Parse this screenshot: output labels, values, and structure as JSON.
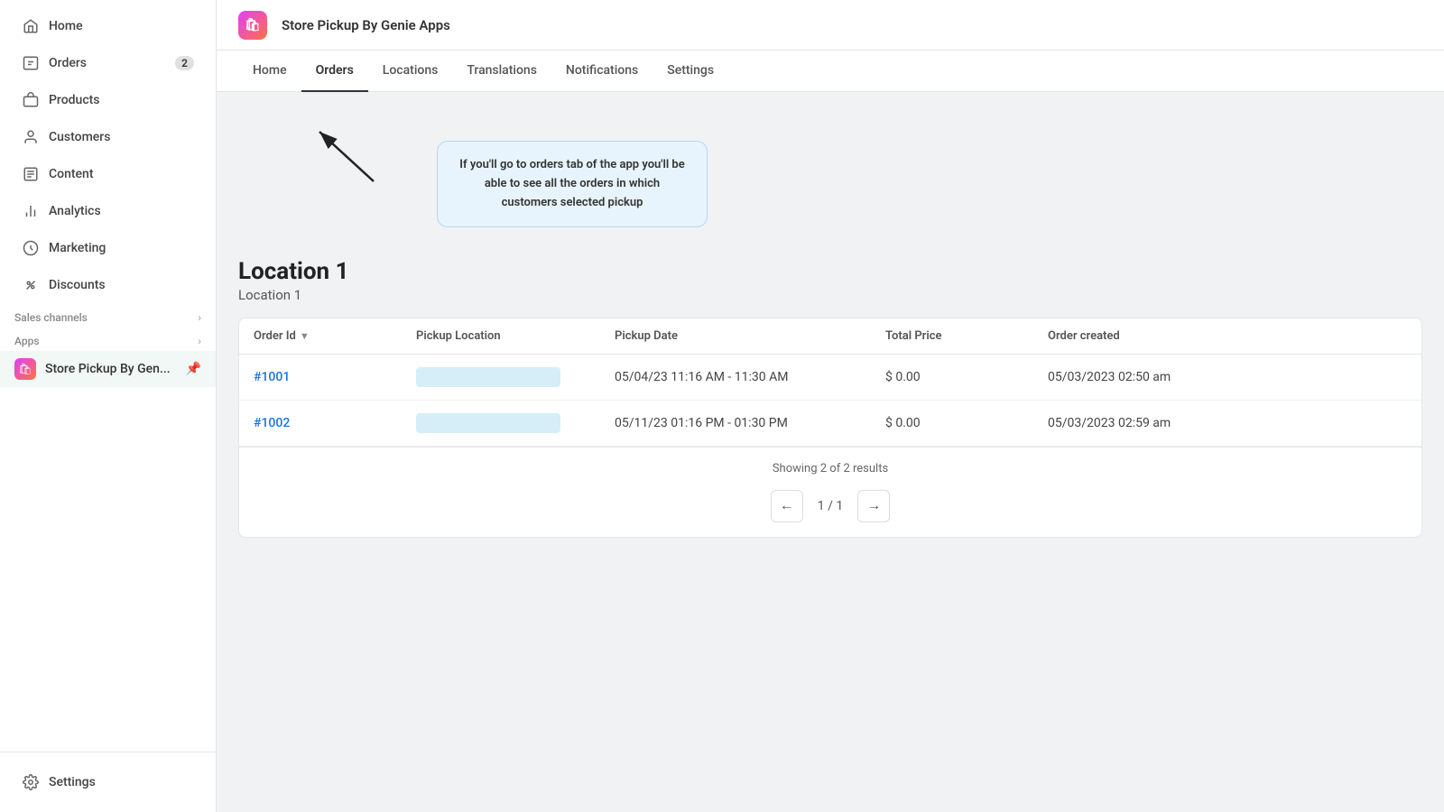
{
  "sidebar": {
    "items": [
      {
        "id": "home",
        "label": "Home",
        "icon": "home-icon",
        "badge": null
      },
      {
        "id": "orders",
        "label": "Orders",
        "icon": "orders-icon",
        "badge": "2"
      },
      {
        "id": "products",
        "label": "Products",
        "icon": "products-icon",
        "badge": null
      },
      {
        "id": "customers",
        "label": "Customers",
        "icon": "customers-icon",
        "badge": null
      },
      {
        "id": "content",
        "label": "Content",
        "icon": "content-icon",
        "badge": null
      },
      {
        "id": "analytics",
        "label": "Analytics",
        "icon": "analytics-icon",
        "badge": null
      },
      {
        "id": "marketing",
        "label": "Marketing",
        "icon": "marketing-icon",
        "badge": null
      },
      {
        "id": "discounts",
        "label": "Discounts",
        "icon": "discounts-icon",
        "badge": null
      }
    ],
    "sales_channels_label": "Sales channels",
    "apps_label": "Apps",
    "settings_label": "Settings",
    "active_app": {
      "name": "Store Pickup By Gen...",
      "icon": "🛍"
    }
  },
  "app_header": {
    "title": "Store Pickup By Genie Apps",
    "icon": "🛍"
  },
  "nav_tabs": [
    {
      "id": "home",
      "label": "Home"
    },
    {
      "id": "orders",
      "label": "Orders",
      "active": true
    },
    {
      "id": "locations",
      "label": "Locations"
    },
    {
      "id": "translations",
      "label": "Translations"
    },
    {
      "id": "notifications",
      "label": "Notifications"
    },
    {
      "id": "settings",
      "label": "Settings"
    }
  ],
  "tooltip": {
    "text": "If you'll go to orders tab of the app you'll be able to see all the orders in which customers selected pickup"
  },
  "location": {
    "title": "Location 1",
    "subtitle": "Location 1"
  },
  "table": {
    "columns": [
      {
        "id": "order_id",
        "label": "Order Id",
        "sortable": true
      },
      {
        "id": "pickup_location",
        "label": "Pickup Location",
        "sortable": false
      },
      {
        "id": "pickup_date",
        "label": "Pickup Date",
        "sortable": false
      },
      {
        "id": "total_price",
        "label": "Total Price",
        "sortable": false
      },
      {
        "id": "order_created",
        "label": "Order created",
        "sortable": false
      }
    ],
    "rows": [
      {
        "order_id": "#1001",
        "pickup_location": "",
        "pickup_date": "05/04/23 11:16 AM - 11:30 AM",
        "total_price": "$ 0.00",
        "order_created": "05/03/2023 02:50 am"
      },
      {
        "order_id": "#1002",
        "pickup_location": "",
        "pickup_date": "05/11/23 01:16 PM - 01:30 PM",
        "total_price": "$ 0.00",
        "order_created": "05/03/2023 02:59 am"
      }
    ],
    "results_text": "Showing 2 of 2 results",
    "pagination": {
      "current": "1",
      "total": "1",
      "display": "1 / 1"
    }
  }
}
